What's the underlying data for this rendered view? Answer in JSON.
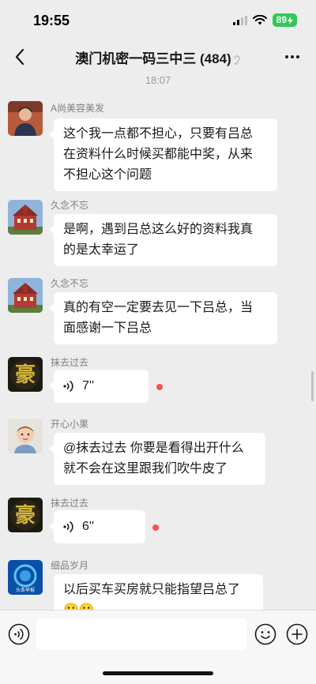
{
  "status": {
    "time": "19:55",
    "battery": "89"
  },
  "chat": {
    "title": "澳门机密一码三中三 (484)"
  },
  "timestamp": "18:07",
  "messages": [
    {
      "sender": "A尚美容美发",
      "lines": [
        "这个我一点都不担心，只要有吕总",
        "在资料什么时候买都能中奖，从来",
        "不担心这个问题"
      ]
    },
    {
      "sender": "久念不忘",
      "lines": [
        "是啊，遇到吕总这么好的资料我真",
        "的是太幸运了"
      ]
    },
    {
      "sender": "久念不忘",
      "lines": [
        "真的有空一定要去见一下吕总，当",
        "面感谢一下吕总"
      ]
    },
    {
      "sender": "抹去过去",
      "voice": "7''"
    },
    {
      "sender": "开心小果",
      "lines": [
        "@抹去过去 你要是看得出开什么",
        "就不会在这里跟我们吹牛皮了"
      ]
    },
    {
      "sender": "抹去过去",
      "voice": "6''"
    },
    {
      "sender": "细品岁月",
      "lines": [
        "以后买车买房就只能指望吕总了",
        "😬😬"
      ],
      "avatar_label": "头条早报"
    }
  ],
  "avatar_seal_char": "豪",
  "colors": {
    "background": "#ededed",
    "bubble": "#ffffff",
    "unread": "#fa5151",
    "battery": "#34c759"
  }
}
